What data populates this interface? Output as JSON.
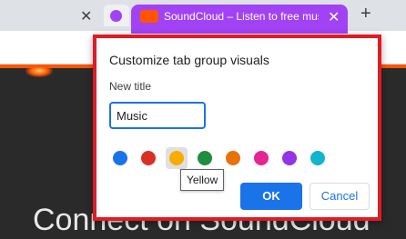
{
  "tabstrip": {
    "left_tab_close": "✕",
    "group_color": "#a142f4",
    "active_tab_title": "SoundCloud – Listen to free mus",
    "active_tab_close": "✕",
    "new_tab": "+"
  },
  "page": {
    "hero_text": "Connect on SoundCloud"
  },
  "dialog": {
    "heading": "Customize tab group visuals",
    "title_label": "New title",
    "title_value": "Music",
    "swatches": [
      {
        "name": "blue",
        "color": "#1a73e8"
      },
      {
        "name": "red",
        "color": "#d93025"
      },
      {
        "name": "yellow",
        "color": "#f9ab00"
      },
      {
        "name": "green",
        "color": "#1e8e3e"
      },
      {
        "name": "orange",
        "color": "#e8710a"
      },
      {
        "name": "pink",
        "color": "#e52592"
      },
      {
        "name": "purple",
        "color": "#9334e6"
      },
      {
        "name": "cyan",
        "color": "#12b5cb"
      }
    ],
    "hovered_swatch_tooltip": "Yellow",
    "ok_label": "OK",
    "cancel_label": "Cancel"
  }
}
